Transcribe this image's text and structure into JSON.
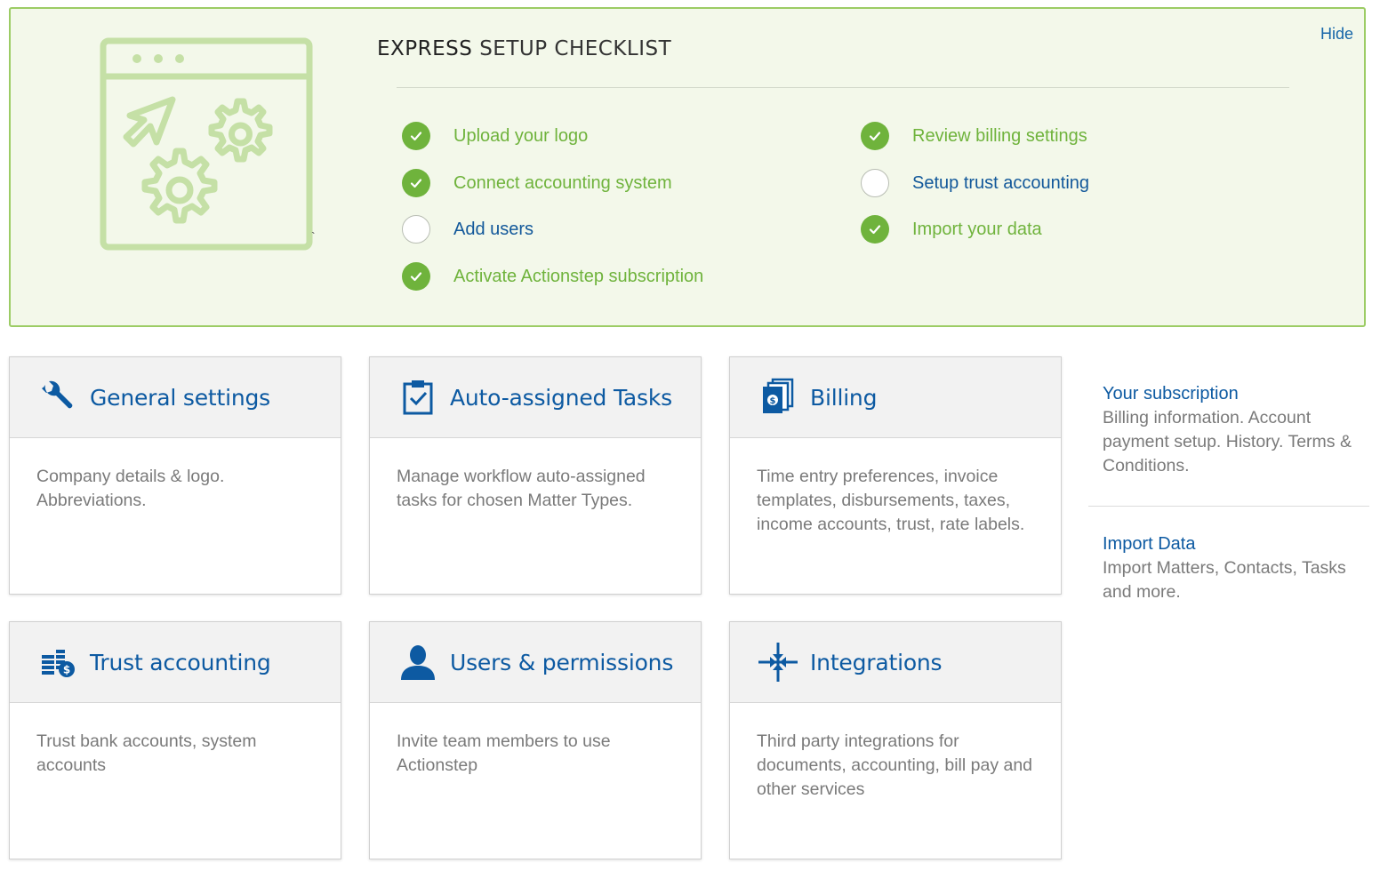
{
  "checklist": {
    "title_part1": "EXPRESS",
    "title_part2": "SETUP CHECKLIST",
    "hide_label": "Hide",
    "stray_mark": "`",
    "items": [
      {
        "label": "Upload your logo",
        "done": true
      },
      {
        "label": "Connect accounting system",
        "done": true
      },
      {
        "label": "Add users",
        "done": false
      },
      {
        "label": "Activate Actionstep subscription",
        "done": true
      },
      {
        "label": "Review billing settings",
        "done": true
      },
      {
        "label": "Setup trust accounting",
        "done": false
      },
      {
        "label": "Import your data",
        "done": true
      }
    ]
  },
  "cards": {
    "general": {
      "title": "General settings",
      "desc": "Company details & logo. Abbreviations.",
      "icon": "wrench-icon"
    },
    "tasks": {
      "title": "Auto-assigned Tasks",
      "desc": "Manage workflow auto-assigned tasks for chosen Matter Types.",
      "icon": "clipboard-check-icon"
    },
    "billing": {
      "title": "Billing",
      "desc": "Time entry preferences, invoice templates, disbursements, taxes, income accounts, trust, rate labels.",
      "icon": "invoices-icon"
    },
    "trust": {
      "title": "Trust accounting",
      "desc": "Trust bank accounts, system accounts",
      "icon": "coin-stacks-icon"
    },
    "users": {
      "title": "Users & permissions",
      "desc": "Invite team members to use Actionstep",
      "icon": "user-icon"
    },
    "integrations": {
      "title": "Integrations",
      "desc": "Third party integrations for documents, accounting, bill pay and other services",
      "icon": "converge-arrows-icon"
    }
  },
  "side": {
    "subscription": {
      "title": "Your subscription",
      "desc": "Billing information. Account payment setup. History. Terms & Conditions."
    },
    "import": {
      "title": "Import Data",
      "desc": "Import Matters, Contacts, Tasks and more."
    }
  },
  "colors": {
    "accent_blue": "#0d5aa2",
    "done_green": "#6fb33c",
    "panel_bg": "#f3f8ea",
    "panel_border": "#9ccc65"
  }
}
